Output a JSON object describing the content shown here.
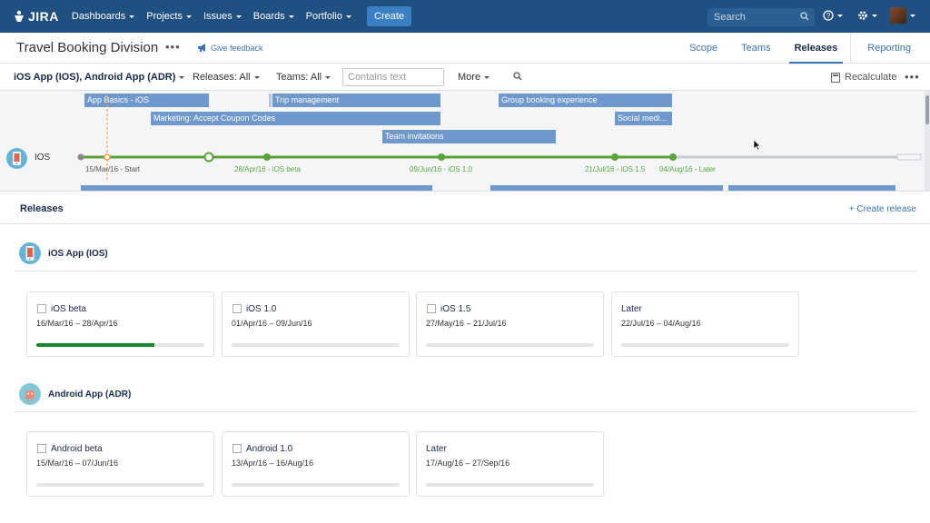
{
  "topnav": {
    "logo": "JIRA",
    "items": [
      "Dashboards",
      "Projects",
      "Issues",
      "Boards",
      "Portfolio"
    ],
    "create_label": "Create",
    "search_placeholder": "Search",
    "icons": [
      "help-icon",
      "gear-icon",
      "user-avatar"
    ]
  },
  "subheader": {
    "title": "Travel Booking Division",
    "feedback": "Give feedback",
    "tabs": [
      "Scope",
      "Teams",
      "Releases",
      "Reporting"
    ],
    "active_tab": "Releases"
  },
  "filterbar": {
    "projects": "iOS App (IOS), Android App (ADR)",
    "releases": "Releases: All",
    "teams": "Teams: All",
    "text_placeholder": "Contains text",
    "more": "More",
    "recalculate": "Recalculate"
  },
  "timeline": {
    "row_label": "IOS",
    "bars": [
      "App Basics - iOS",
      "Trip management",
      "Group booking experience",
      "Marketing: Accept Coupon Codes",
      "Social medi...",
      "Team invitations"
    ],
    "milestones": [
      "15/Mar/16 - Start",
      "28/Apr/16 - iOS beta",
      "09/Jun/16 - iOS 1.0",
      "21/Jul/16 - iOS 1.5",
      "04/Aug/16 - Later"
    ]
  },
  "releases": {
    "title": "Releases",
    "create": "+ Create release",
    "projects": [
      {
        "name": "iOS App (IOS)",
        "cards": [
          {
            "name": "iOS beta",
            "dates": "16/Mar/16 – 28/Apr/16",
            "progress": 0.7,
            "checkbox": true
          },
          {
            "name": "iOS 1.0",
            "dates": "01/Apr/16 – 09/Jun/16",
            "progress": 0,
            "checkbox": true
          },
          {
            "name": "iOS 1.5",
            "dates": "27/May/16 – 21/Jul/16",
            "progress": 0,
            "checkbox": true
          },
          {
            "name": "Later",
            "dates": "22/Jul/16 – 04/Aug/16",
            "progress": 0,
            "checkbox": false
          }
        ]
      },
      {
        "name": "Android App (ADR)",
        "cards": [
          {
            "name": "Android beta",
            "dates": "15/Mar/16 – 07/Jun/16",
            "progress": 0,
            "checkbox": true
          },
          {
            "name": "Android 1.0",
            "dates": "13/Apr/16 – 16/Aug/16",
            "progress": 0,
            "checkbox": true
          },
          {
            "name": "Later",
            "dates": "17/Aug/16 – 27/Sep/16",
            "progress": 0,
            "checkbox": false
          }
        ]
      }
    ]
  },
  "colors": {
    "nav": "#205081",
    "bar": "#6f98cd",
    "milestone": "#5aa33a",
    "progress": "#14892c",
    "link": "#3b73af"
  }
}
